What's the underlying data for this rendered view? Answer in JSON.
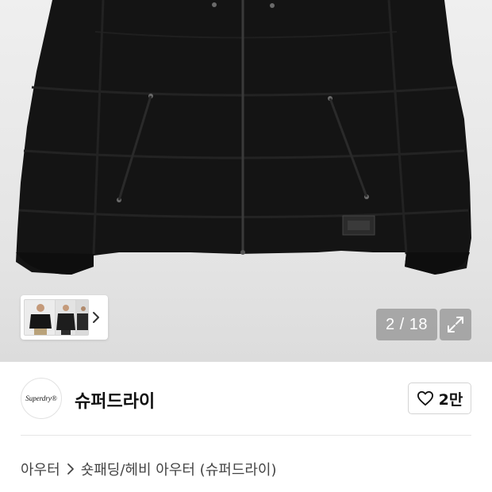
{
  "gallery": {
    "current_index": "2",
    "separator": "/",
    "total": "18",
    "counter_text": "2 / 18",
    "expand_icon": "expand-icon",
    "thumbnails_next_icon": "chevron-right-icon"
  },
  "brand": {
    "logo_text": "Superdry®",
    "name": "슈퍼드라이",
    "like_icon": "heart-outline-icon",
    "like_count": "2만"
  },
  "breadcrumb": {
    "items": [
      "아우터",
      "숏패딩/헤비 아우터 (슈퍼드라이)"
    ],
    "separator_icon": "chevron-right-icon"
  },
  "colors": {
    "gallery_bg": "#e6e6e6",
    "jacket": "#121212",
    "overlay": "#7f7f7f",
    "text_primary": "#111111",
    "text_secondary": "#444444"
  }
}
